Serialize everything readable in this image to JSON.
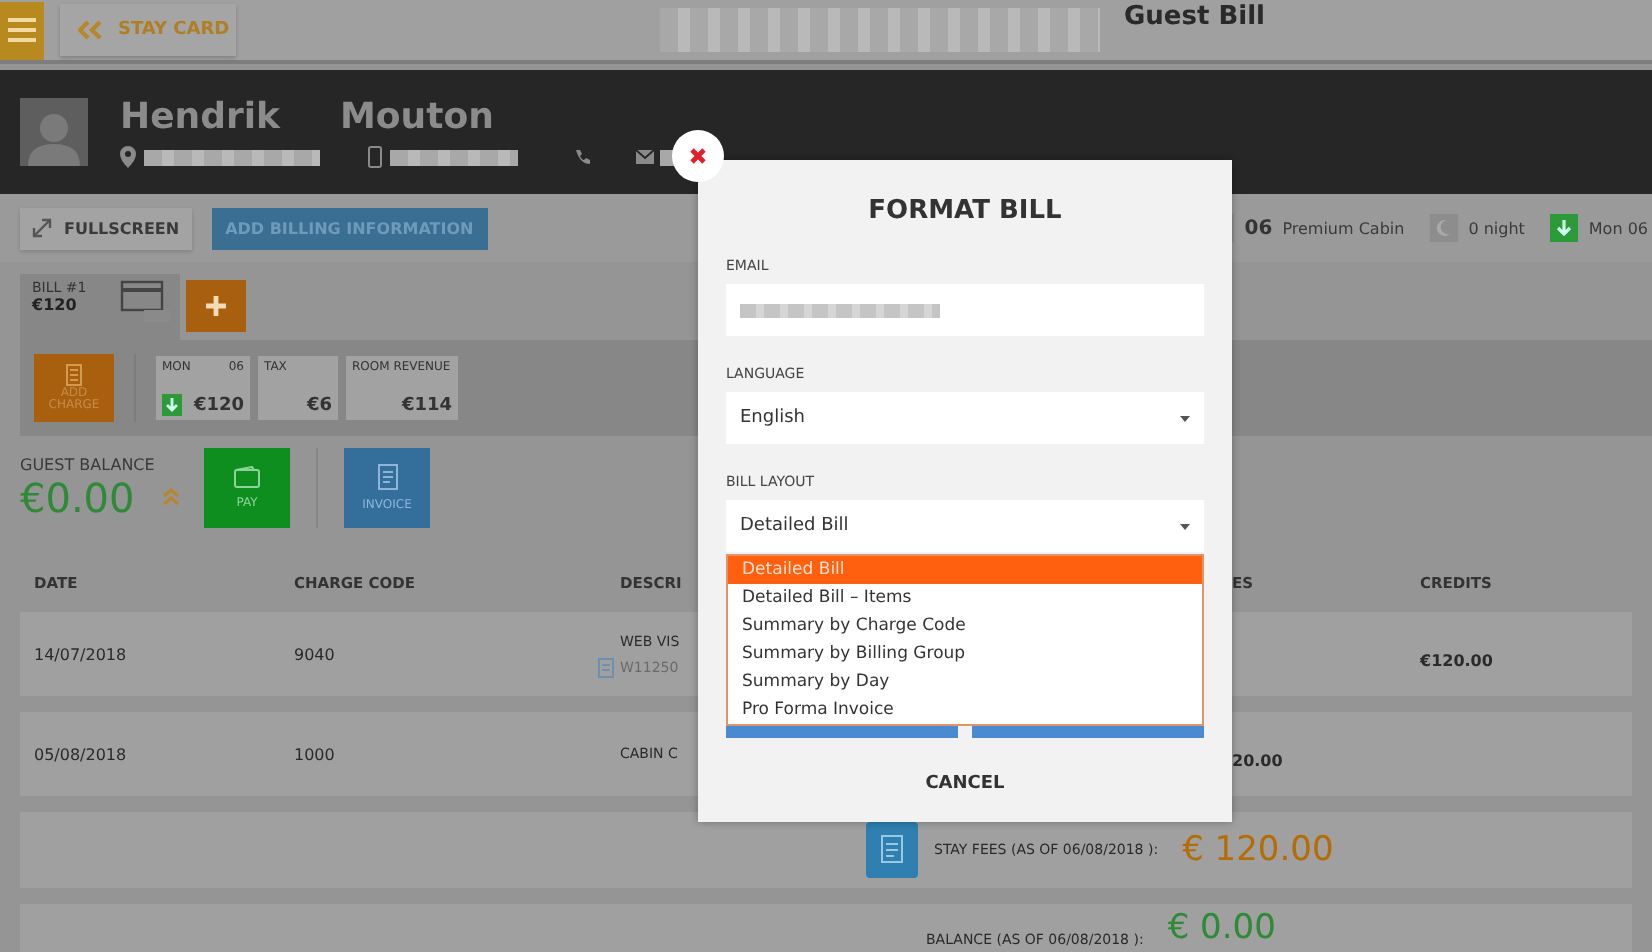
{
  "top_bar": {
    "back_button": "STAY CARD",
    "title": "Guest Bill"
  },
  "guest": {
    "first_name": "Hendrik",
    "last_name": "Mouton"
  },
  "toolbar": {
    "buttons": [
      {
        "label": "FULLSCREEN",
        "kind": "fullscreen"
      },
      {
        "label": "ADD BILLING INFORMATION",
        "kind": "primary"
      }
    ],
    "room_number": "06",
    "room_type": "Premium Cabin",
    "nights": "0 night",
    "arrival": "Mon 06"
  },
  "bill": {
    "label": "BILL #1",
    "amount": "€120",
    "add_charge": "ADD CHARGE",
    "tiles": [
      {
        "label": "MON",
        "day": "06",
        "value": "€120",
        "kind": "day"
      },
      {
        "label": "TAX",
        "value": "€6",
        "kind": "plain"
      },
      {
        "label": "ROOM REVENUE",
        "value": "€114",
        "kind": "plain"
      }
    ]
  },
  "balance": {
    "label": "GUEST BALANCE",
    "amount": "€0.00",
    "actions": [
      {
        "label": "PAY",
        "kind": "pay"
      },
      {
        "label": "INVOICE",
        "kind": "invoice"
      }
    ]
  },
  "table": {
    "columns": [
      "DATE",
      "CHARGE CODE",
      "DESCRI",
      "ES",
      "CREDITS"
    ],
    "rows": [
      {
        "date": "14/07/2018",
        "code": "9040",
        "description": "WEB VIS",
        "reference": "W11250",
        "credit": "€120.00"
      },
      {
        "date": "05/08/2018",
        "code": "1000",
        "description": "CABIN C",
        "debit": "20.00"
      }
    ]
  },
  "totals": [
    {
      "label": "STAY FEES (AS OF 06/08/2018 ):",
      "amount": "€ 120.00",
      "kind": "fees"
    },
    {
      "label": "BALANCE (AS OF 06/08/2018 ):",
      "amount": "€ 0.00",
      "kind": "balance"
    }
  ],
  "dialog": {
    "title": "FORMAT BILL",
    "email_label": "EMAIL",
    "language_label": "LANGUAGE",
    "language": "English",
    "layout_label": "BILL LAYOUT",
    "layout": "Detailed Bill",
    "layout_options": [
      {
        "label": "Detailed Bill",
        "selected": true
      },
      {
        "label": "Detailed Bill – Items",
        "selected": false
      },
      {
        "label": "Summary by Charge Code",
        "selected": false
      },
      {
        "label": "Summary by Billing Group",
        "selected": false
      },
      {
        "label": "Summary by Day",
        "selected": false
      },
      {
        "label": "Pro Forma Invoice",
        "selected": false
      }
    ],
    "cancel": "CANCEL"
  }
}
